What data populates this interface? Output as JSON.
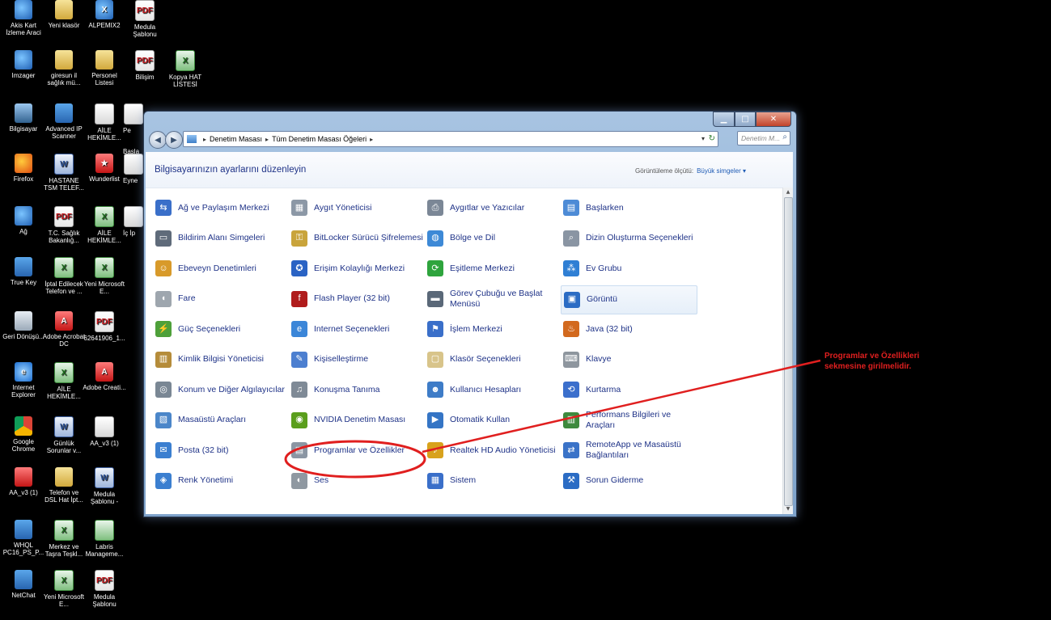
{
  "desktop_icons": [
    {
      "label": "Akis Kart İzleme Araci",
      "kind": "app",
      "icon": "card-reader-icon",
      "glyph": ""
    },
    {
      "label": "Yeni klasör",
      "kind": "folder",
      "icon": "folder-icon",
      "glyph": ""
    },
    {
      "label": "ALPEMIX2",
      "kind": "app",
      "icon": "remote-desktop-icon",
      "glyph": "X"
    },
    {
      "label": "Medula Şablonu",
      "kind": "pdf",
      "icon": "pdf-icon",
      "glyph": "PDF"
    },
    {
      "label": "Imzager",
      "kind": "app",
      "icon": "signature-app-icon",
      "glyph": ""
    },
    {
      "label": "giresun il sağlık mü...",
      "kind": "folder",
      "icon": "folder-icon",
      "glyph": ""
    },
    {
      "label": "Personel Listesi",
      "kind": "folder",
      "icon": "folder-icon",
      "glyph": ""
    },
    {
      "label": "Bilişim",
      "kind": "pdf",
      "icon": "pdf-icon",
      "glyph": "PDF"
    },
    {
      "label": "Kopya HAT LİSTESİ",
      "kind": "excel",
      "icon": "excel-icon",
      "glyph": "X"
    },
    {
      "label": "Bilgisayar",
      "kind": "pc",
      "icon": "computer-icon",
      "glyph": ""
    },
    {
      "label": "Advanced IP Scanner",
      "kind": "blue",
      "icon": "ip-scanner-icon",
      "glyph": ""
    },
    {
      "label": "AİLE HEKİMLE...",
      "kind": "file",
      "icon": "file-icon",
      "glyph": ""
    },
    {
      "label": "Pe",
      "kind": "file",
      "icon": "file-icon",
      "glyph": ""
    },
    {
      "label": "Başla",
      "kind": "file",
      "icon": "file-icon",
      "glyph": ""
    },
    {
      "label": "Firefox",
      "kind": "fire",
      "icon": "firefox-icon",
      "glyph": ""
    },
    {
      "label": "HASTANE TSM TELEF...",
      "kind": "word",
      "icon": "word-icon",
      "glyph": "W"
    },
    {
      "label": "Wunderlist",
      "kind": "red",
      "icon": "wunderlist-icon",
      "glyph": "★"
    },
    {
      "label": "Eyne",
      "kind": "file",
      "icon": "file-icon",
      "glyph": ""
    },
    {
      "label": "Ağ",
      "kind": "app",
      "icon": "network-icon",
      "glyph": ""
    },
    {
      "label": "T.C. Sağlık Bakanlığ...",
      "kind": "pdf",
      "icon": "pdf-icon",
      "glyph": "PDF"
    },
    {
      "label": "AİLE HEKİMLE...",
      "kind": "excel",
      "icon": "excel-icon",
      "glyph": "X"
    },
    {
      "label": "İç İp",
      "kind": "file",
      "icon": "file-icon",
      "glyph": ""
    },
    {
      "label": "True Key",
      "kind": "blue",
      "icon": "true-key-icon",
      "glyph": ""
    },
    {
      "label": "İptal Edilecek Telefon ve ...",
      "kind": "excel",
      "icon": "excel-icon",
      "glyph": "X"
    },
    {
      "label": "Yeni Microsoft E...",
      "kind": "excel",
      "icon": "excel-icon",
      "glyph": "X"
    },
    {
      "label": "Geri Dönüşü...",
      "kind": "trash",
      "icon": "recycle-bin-icon",
      "glyph": ""
    },
    {
      "label": "Adobe Acrobat DC",
      "kind": "red",
      "icon": "acrobat-icon",
      "glyph": "A"
    },
    {
      "label": "62641906_1...",
      "kind": "pdf",
      "icon": "pdf-icon",
      "glyph": "PDF"
    },
    {
      "label": "Internet Explorer",
      "kind": "ie",
      "icon": "internet-explorer-icon",
      "glyph": "e"
    },
    {
      "label": "AİLE HEKİMLE...",
      "kind": "excel",
      "icon": "excel-icon",
      "glyph": "X"
    },
    {
      "label": "Adobe Creati...",
      "kind": "red",
      "icon": "adobe-creative-icon",
      "glyph": "A"
    },
    {
      "label": "Google Chrome",
      "kind": "chrome",
      "icon": "chrome-icon",
      "glyph": ""
    },
    {
      "label": "Günlük Sorunlar v...",
      "kind": "word",
      "icon": "word-icon",
      "glyph": "W"
    },
    {
      "label": "AA_v3 (1)",
      "kind": "file",
      "icon": "file-icon",
      "glyph": ""
    },
    {
      "label": "AA_v3 (1)",
      "kind": "red",
      "icon": "ammyy-admin-icon",
      "glyph": ""
    },
    {
      "label": "Telefon ve DSL Hat İpt...",
      "kind": "folder",
      "icon": "folder-icon",
      "glyph": ""
    },
    {
      "label": "Medula Şablonu -",
      "kind": "word",
      "icon": "word-icon",
      "glyph": "W"
    },
    {
      "label": "WHQL PC16_PS_P...",
      "kind": "blue",
      "icon": "driver-icon",
      "glyph": ""
    },
    {
      "label": "Merkez ve Taşra Teşkl...",
      "kind": "excel",
      "icon": "excel-icon",
      "glyph": "X"
    },
    {
      "label": "Labris Manageme...",
      "kind": "excel",
      "icon": "labris-icon",
      "glyph": ""
    },
    {
      "label": "NetChat",
      "kind": "blue",
      "icon": "netchat-icon",
      "glyph": ""
    },
    {
      "label": "Yeni Microsoft E...",
      "kind": "excel",
      "icon": "excel-icon",
      "glyph": "X"
    },
    {
      "label": "Medula Şablonu",
      "kind": "pdf",
      "icon": "pdf-icon",
      "glyph": "PDF"
    }
  ],
  "window": {
    "title_buttons": {
      "minimize": "▁",
      "maximize": "□",
      "close": "✕"
    },
    "nav": {
      "back": "◀",
      "forward": "▶"
    },
    "breadcrumb": {
      "root": "Denetim Masası",
      "current": "Tüm Denetim Masası Öğeleri",
      "sep": "▸"
    },
    "search_placeholder": "Denetim M...",
    "page_title": "Bilgisayarınızın ayarlarını düzenleyin",
    "view_by": {
      "label": "Görüntüleme ölçütü:",
      "value": "Büyük simgeler ▾"
    }
  },
  "items": [
    {
      "label": "Ağ ve Paylaşım Merkezi",
      "icon": "network-sharing-icon",
      "color": "#3a6fc9",
      "glyph": "⇆"
    },
    {
      "label": "Aygıt Yöneticisi",
      "icon": "device-manager-icon",
      "color": "#8c98a6",
      "glyph": "▦"
    },
    {
      "label": "Aygıtlar ve Yazıcılar",
      "icon": "printer-icon",
      "color": "#7b8796",
      "glyph": "⎙"
    },
    {
      "label": "Başlarken",
      "icon": "getting-started-icon",
      "color": "#4d8bd6",
      "glyph": "▤"
    },
    {
      "label": "Bildirim Alanı Simgeleri",
      "icon": "notification-area-icon",
      "color": "#5f6b7a",
      "glyph": "▭"
    },
    {
      "label": "BitLocker Sürücü Şifrelemesi",
      "icon": "bitlocker-icon",
      "color": "#c9a43b",
      "glyph": "⚿"
    },
    {
      "label": "Bölge ve Dil",
      "icon": "region-language-icon",
      "color": "#3d89d6",
      "glyph": "◍"
    },
    {
      "label": "Dizin Oluşturma Seçenekleri",
      "icon": "indexing-icon",
      "color": "#8a95a3",
      "glyph": "⌕"
    },
    {
      "label": "Ebeveyn Denetimleri",
      "icon": "parental-controls-icon",
      "color": "#d89a2a",
      "glyph": "☺"
    },
    {
      "label": "Erişim Kolaylığı Merkezi",
      "icon": "ease-of-access-icon",
      "color": "#2a63c4",
      "glyph": "✪"
    },
    {
      "label": "Eşitleme Merkezi",
      "icon": "sync-center-icon",
      "color": "#2ea43d",
      "glyph": "⟳"
    },
    {
      "label": "Ev Grubu",
      "icon": "homegroup-icon",
      "color": "#2f7fd4",
      "glyph": "⁂"
    },
    {
      "label": "Fare",
      "icon": "mouse-icon",
      "color": "#9ea6ae",
      "glyph": "◖"
    },
    {
      "label": "Flash Player (32 bit)",
      "icon": "flash-player-icon",
      "color": "#b01c1c",
      "glyph": "f"
    },
    {
      "label": "Görev Çubuğu ve Başlat Menüsü",
      "icon": "taskbar-icon",
      "color": "#5a6878",
      "glyph": "▬"
    },
    {
      "label": "Görüntü",
      "icon": "display-icon",
      "color": "#2b6cc4",
      "glyph": "▣"
    },
    {
      "label": "Güç Seçenekleri",
      "icon": "power-options-icon",
      "color": "#4ea03a",
      "glyph": "⚡"
    },
    {
      "label": "Internet Seçenekleri",
      "icon": "internet-options-icon",
      "color": "#3b86d8",
      "glyph": "e"
    },
    {
      "label": "İşlem Merkezi",
      "icon": "action-center-icon",
      "color": "#3a6fc9",
      "glyph": "⚑"
    },
    {
      "label": "Java (32 bit)",
      "icon": "java-icon",
      "color": "#d2691e",
      "glyph": "♨"
    },
    {
      "label": "Kimlik Bilgisi Yöneticisi",
      "icon": "credential-manager-icon",
      "color": "#b58c3a",
      "glyph": "▥"
    },
    {
      "label": "Kişiselleştirme",
      "icon": "personalization-icon",
      "color": "#4c7fd0",
      "glyph": "✎"
    },
    {
      "label": "Klasör Seçenekleri",
      "icon": "folder-options-icon",
      "color": "#d8c48a",
      "glyph": "▢"
    },
    {
      "label": "Klavye",
      "icon": "keyboard-icon",
      "color": "#8e969e",
      "glyph": "⌨"
    },
    {
      "label": "Konum ve Diğer Algılayıcılar",
      "icon": "location-sensors-icon",
      "color": "#7a8794",
      "glyph": "◎"
    },
    {
      "label": "Konuşma Tanıma",
      "icon": "microphone-icon",
      "color": "#7f8a96",
      "glyph": "♫"
    },
    {
      "label": "Kullanıcı Hesapları",
      "icon": "user-accounts-icon",
      "color": "#3e7cc7",
      "glyph": "☻"
    },
    {
      "label": "Kurtarma",
      "icon": "recovery-icon",
      "color": "#3b6fcc",
      "glyph": "⟲"
    },
    {
      "label": "Masaüstü Araçları",
      "icon": "desktop-gadgets-icon",
      "color": "#4b86c9",
      "glyph": "▧"
    },
    {
      "label": "NVIDIA Denetim Masası",
      "icon": "nvidia-icon",
      "color": "#5a9e1c",
      "glyph": "◉"
    },
    {
      "label": "Otomatik Kullan",
      "icon": "autoplay-icon",
      "color": "#3575c5",
      "glyph": "▶"
    },
    {
      "label": "Performans Bilgileri ve Araçları",
      "icon": "performance-icon",
      "color": "#3e8a3e",
      "glyph": "▥"
    },
    {
      "label": "Posta (32 bit)",
      "icon": "mail-icon",
      "color": "#3b7fd0",
      "glyph": "✉"
    },
    {
      "label": "Programlar ve Özellikler",
      "icon": "programs-features-icon",
      "color": "#8b96a3",
      "glyph": "▤"
    },
    {
      "label": "Realtek HD Audio Yöneticisi",
      "icon": "realtek-audio-icon",
      "color": "#d8a21c",
      "glyph": "♪"
    },
    {
      "label": "RemoteApp ve Masaüstü Bağlantıları",
      "icon": "remoteapp-icon",
      "color": "#3a73c8",
      "glyph": "⇄"
    },
    {
      "label": "Renk Yönetimi",
      "icon": "color-management-icon",
      "color": "#3b7fd0",
      "glyph": "◈"
    },
    {
      "label": "Ses",
      "icon": "sound-icon",
      "color": "#8f98a1",
      "glyph": "◐"
    },
    {
      "label": "Sistem",
      "icon": "system-icon",
      "color": "#3a6fc9",
      "glyph": "▦"
    },
    {
      "label": "Sorun Giderme",
      "icon": "troubleshooting-icon",
      "color": "#2b6cc4",
      "glyph": "⚒"
    }
  ],
  "annotation": "Programlar ve Özellikleri sekmesine girilmelidir.",
  "annotation_color": "#e01f1f"
}
